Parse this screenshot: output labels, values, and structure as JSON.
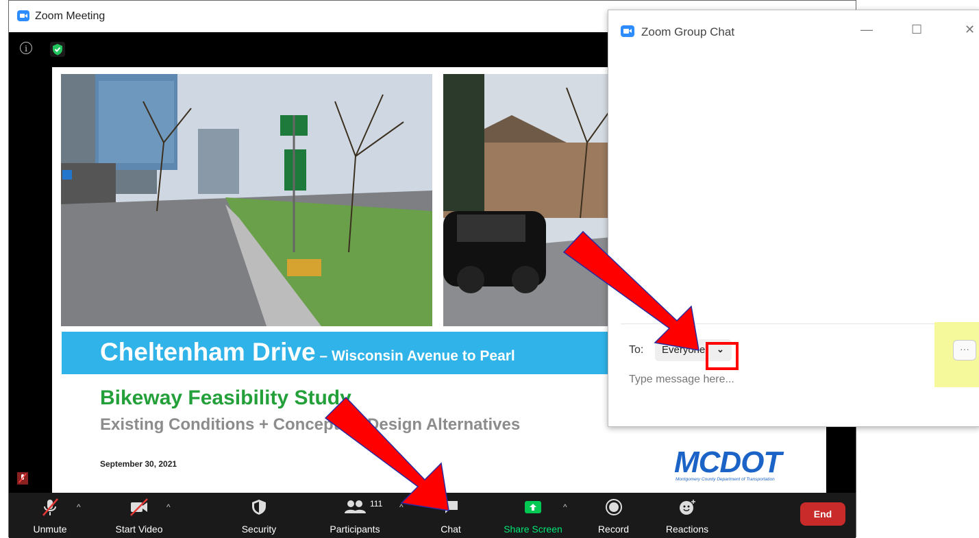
{
  "meeting_window": {
    "title": "Zoom Meeting",
    "info_symbol": "i"
  },
  "slide": {
    "title_main": "Cheltenham Drive",
    "title_sub": " – Wisconsin Avenue to Pearl",
    "heading": "Bikeway Feasibility Study",
    "subheading": "Existing Conditions + Conceptual Design Alternatives",
    "date": "September 30, 2021",
    "logo": "MCDOT",
    "logo_caption": "Montgomery County Department of Transportation"
  },
  "toolbar": {
    "unmute": "Unmute",
    "start_video": "Start Video",
    "security": "Security",
    "participants": "Participants",
    "participant_count": "111",
    "chat": "Chat",
    "share_screen": "Share Screen",
    "record": "Record",
    "reactions": "Reactions",
    "end": "End",
    "caret": "^"
  },
  "chat_window": {
    "title": "Zoom Group Chat",
    "minimize": "—",
    "maximize": "☐",
    "close": "✕",
    "to_label": "To:",
    "recipient": "Everyone",
    "message_placeholder": "Type message here...",
    "more_label": "···"
  },
  "colors": {
    "zoom_blue": "#2D8CFF",
    "slide_band": "#2FB3E8",
    "heading_green": "#23A03A",
    "share_green": "#00C853",
    "end_red": "#C92A2A",
    "annotation_red": "#FF0000",
    "highlight_yellow": "#F5F99B"
  }
}
